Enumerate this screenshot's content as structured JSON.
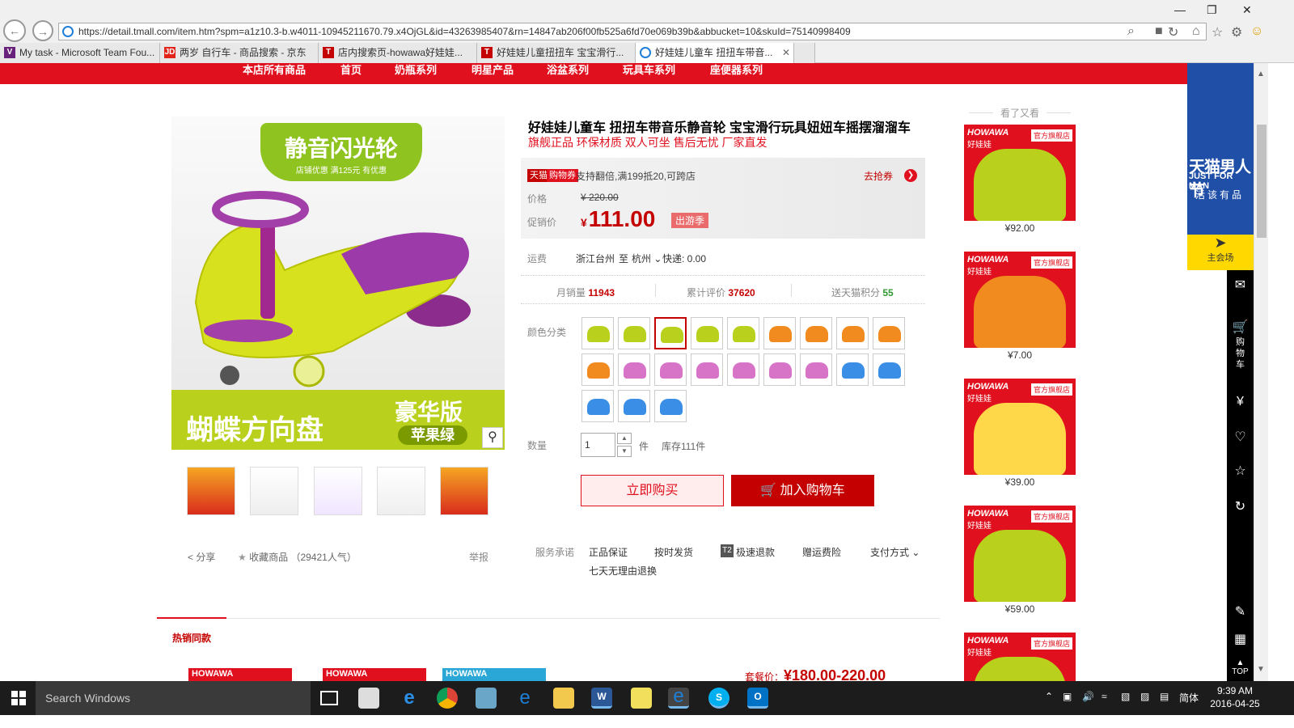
{
  "browser": {
    "url": "https://detail.tmall.com/item.htm?spm=a1z10.3-b.w4011-10945211670.79.x4OjGL&id=43263985407&rn=14847ab206f00fb525a6fd70e069b39b&abbucket=10&skuId=75140998409",
    "tabs": [
      {
        "label": "My task - Microsoft Team Fou...",
        "icon_color": "#68217a",
        "icon": "vs-icon"
      },
      {
        "label": "两岁 自行车 - 商品搜索 - 京东",
        "icon_color": "#e1251b",
        "icon": "jd-icon"
      },
      {
        "label": "店内搜索页-howawa好娃娃...",
        "icon_color": "#c40000",
        "icon": "tmall-icon"
      },
      {
        "label": "好娃娃儿童扭扭车 宝宝滑行...",
        "icon_color": "#c40000",
        "icon": "tmall-icon"
      },
      {
        "label": "好娃娃儿童车 扭扭车带音...",
        "icon_color": "#1e7fd6",
        "icon": "ie-icon"
      }
    ]
  },
  "site_nav": [
    "本店所有商品",
    "首页",
    "奶瓶系列",
    "明星产品",
    "浴盆系列",
    "玩具车系列",
    "座便器系列"
  ],
  "product": {
    "title": "好娃娃儿童车 扭扭车带音乐静音轮 宝宝滑行玩具妞妞车摇摆溜溜车",
    "subtitle": "旗舰正品 环保材质 双人可坐 售后无忧 厂家直发",
    "main_image": {
      "banner_title": "静音闪光轮",
      "banner_sub": "店铺优惠 满125元 有优惠",
      "bottom_left": "蝴蝶方向盘",
      "bottom_right_1": "豪华版",
      "bottom_right_2": "苹果绿"
    },
    "coupon": {
      "tag1": "天猫",
      "tag2": "购物券",
      "text": "支持翻倍,满199抵20,可跨店",
      "link": "去抢券"
    },
    "price_label": "价格",
    "price": "¥ 220.00",
    "promo_label": "促销价",
    "promo_currency": "¥",
    "promo_price": "111.00",
    "promo_tag": "出游季",
    "shipping_label": "运费",
    "ship_from": "浙江台州",
    "ship_to_word": "至",
    "ship_to": "杭州",
    "ship_fee": "快递: 0.00",
    "stats": [
      {
        "label": "月销量",
        "value": "11943",
        "color": "#c40000"
      },
      {
        "label": "累计评价",
        "value": "37620",
        "color": "#c40000"
      },
      {
        "label": "送天猫积分",
        "value": "55",
        "color": "#2f9a2f"
      }
    ],
    "color_label": "颜色分类",
    "swatches": [
      "#b9d11d",
      "#b9d11d",
      "#b9d11d",
      "#b9d11d",
      "#b9d11d",
      "#f18b1f",
      "#f18b1f",
      "#f18b1f",
      "#f18b1f",
      "#f18b1f",
      "#d774c7",
      "#d774c7",
      "#d774c7",
      "#d774c7",
      "#d774c7",
      "#d774c7",
      "#3a8ee6",
      "#3a8ee6",
      "#3a8ee6",
      "#3a8ee6",
      "#3a8ee6"
    ],
    "quantity_label": "数量",
    "quantity": "1",
    "unit": "件",
    "stock": "库存111件",
    "buy_now": "立即购买",
    "add_cart": "加入购物车",
    "share": "分享",
    "favorite": "收藏商品 （29421人气）",
    "report": "举报",
    "service_label": "服务承诺",
    "services": [
      "正品保证",
      "按时发货",
      "极速退款",
      "赠运费险",
      "支付方式",
      "七天无理由退换"
    ],
    "t2_badge": "T2"
  },
  "hot": {
    "tab": "热销同款",
    "thumb_labels": [
      "HOWAWA",
      "HOWAWA",
      "HOWAWA"
    ],
    "combo_label": "套餐价：",
    "combo_price": "¥180.00-220.00"
  },
  "recommend": {
    "title": "看了又看",
    "brand": "HOWAWA",
    "brand_cn": "好娃娃",
    "shop_tag": "官方旗舰店",
    "items": [
      {
        "price": "¥92.00",
        "color": "#b9d11d"
      },
      {
        "price": "¥7.00",
        "color": "#f18b1f"
      },
      {
        "price": "¥39.00",
        "color": "#ffd84a"
      },
      {
        "price": "¥59.00",
        "color": "#b9d11d"
      },
      {
        "price": "",
        "color": "#b9d11d"
      }
    ]
  },
  "tmall_side": {
    "promo_1": "天猫男人节",
    "promo_2": "JUST FOR MAN",
    "promo_3": "活该有品",
    "venue": "主会场",
    "cart": "购物车",
    "top": "TOP"
  },
  "taskbar": {
    "search": "Search Windows",
    "time": "9:39 AM",
    "date": "2016-04-25",
    "lang": "简体"
  }
}
